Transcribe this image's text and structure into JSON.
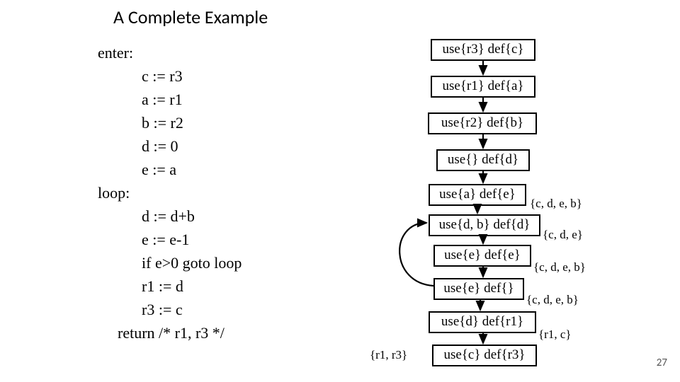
{
  "title": "A Complete Example",
  "code": {
    "enter": "enter:",
    "c": "c := r3",
    "a": "a := r1",
    "b": "b := r2",
    "d": "d := 0",
    "e": "e := a",
    "loop": "loop:",
    "d2": "d := d+b",
    "e2": "e := e-1",
    "goto": "if e>0 goto loop",
    "r1": "r1 := d",
    "r3": "r3 := c",
    "ret": "return /* r1, r3 */"
  },
  "right": {
    "box": {
      "b1": "use{r3}  def{c}",
      "b2": "use{r1}  def{a}",
      "b3": "use{r2}  def{b}",
      "b4": "use{}  def{d}",
      "b5": "use{a}  def{e}",
      "b6": "use{d, b}  def{d}",
      "b7": "use{e}  def{e}",
      "b8": "use{e}  def{}",
      "b9": "use{d}  def{r1}",
      "b10": "use{c}  def{r3}"
    },
    "annot": {
      "a5": "{c, d, e, b}",
      "a6": "{c, d, e}",
      "a7": "{c, d, e, b}",
      "a8": "{c, d, e, b}",
      "a9": "{r1, c}"
    }
  },
  "leftset": "{r1, r3}",
  "pagenum": "27"
}
